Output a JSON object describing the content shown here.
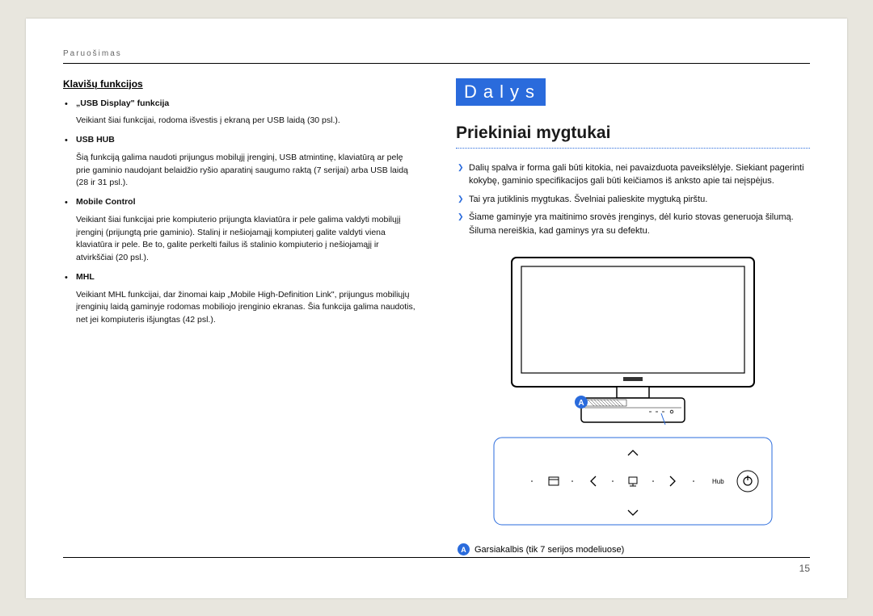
{
  "header": "Paruošimas",
  "pageNumber": "15",
  "left": {
    "title": "Klavišų funkcijos",
    "items": [
      {
        "label": "„USB Display\" funkcija",
        "desc": "Veikiant šiai funkcijai, rodoma išvestis į ekraną per USB laidą (30 psl.)."
      },
      {
        "label": "USB HUB",
        "desc": "Šią funkciją galima naudoti prijungus mobilųjį įrenginį, USB atmintinę, klaviatūrą ar pelę prie gaminio naudojant belaidžio ryšio aparatinį saugumo raktą (7 serijai) arba USB laidą (28 ir 31 psl.)."
      },
      {
        "label": "Mobile Control",
        "desc": "Veikiant šiai funkcijai prie kompiuterio prijungta klaviatūra ir pele galima valdyti mobilųjį įrenginį (prijungtą prie gaminio). Stalinį ir nešiojamąjį kompiuterį galite valdyti viena klaviatūra ir pele. Be to, galite perkelti failus iš stalinio kompiuterio į nešiojamąjį ir atvirkščiai (20 psl.)."
      },
      {
        "label": "MHL",
        "desc": "Veikiant MHL funkcijai, dar žinomai kaip „Mobile High-Definition Link\", prijungus mobiliųjų įrenginių laidą gaminyje rodomas mobiliojo įrenginio ekranas. Šia funkcija galima naudotis, net jei kompiuteris išjungtas (42 psl.)."
      }
    ]
  },
  "right": {
    "chapter": "Dalys",
    "section": "Priekiniai mygtukai",
    "notes": [
      "Dalių spalva ir forma gali būti kitokia, nei pavaizduota paveikslėlyje. Siekiant pagerinti kokybę, gaminio specifikacijos gali būti keičiamos iš anksto apie tai neįspėjus.",
      "Tai yra jutiklinis mygtukas. Švelniai palieskite mygtuką pirštu.",
      "Šiame gaminyje yra maitinimo srovės įrenginys, dėl kurio stovas generuoja šilumą. Šiluma nereiškia, kad gaminys yra su defektu."
    ],
    "legend": {
      "marker": "A",
      "text": "Garsiakalbis (tik 7 serijos modeliuose)"
    },
    "hubLabel": "Hub"
  }
}
